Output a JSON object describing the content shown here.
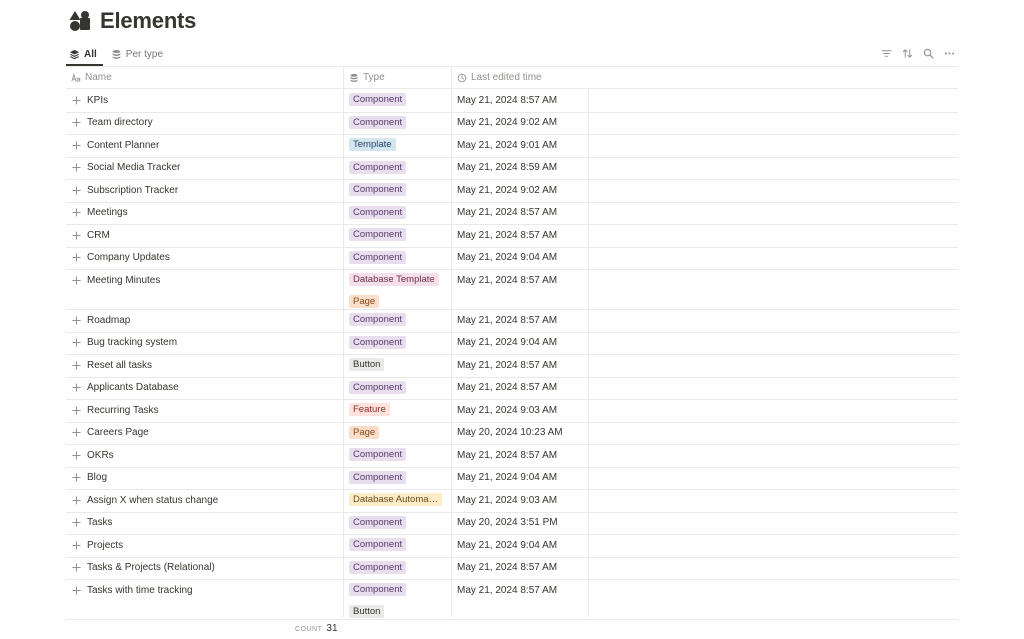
{
  "page": {
    "title": "Elements",
    "icon": "shapes-icon"
  },
  "tabs": [
    {
      "label": "All",
      "icon": "layers-icon",
      "active": true
    },
    {
      "label": "Per type",
      "icon": "database-icon",
      "active": false
    }
  ],
  "toolbar": {
    "icons": [
      "filter-icon",
      "sort-icon",
      "search-icon",
      "more-icon"
    ]
  },
  "columns": {
    "name": {
      "label": "Name",
      "icon": "text-type-icon"
    },
    "type": {
      "label": "Type",
      "icon": "database-icon"
    },
    "time": {
      "label": "Last edited time",
      "icon": "clock-icon"
    }
  },
  "tag_colors": {
    "Component": {
      "bg": "#e8deee",
      "fg": "#5a3a6e"
    },
    "Template": {
      "bg": "#d3e5ef",
      "fg": "#28456c"
    },
    "Database Template": {
      "bg": "#f5e0e9",
      "fg": "#6e2f4a"
    },
    "Page": {
      "bg": "#fadec9",
      "fg": "#854c1d"
    },
    "Button": {
      "bg": "#e9e9e7",
      "fg": "#37352f"
    },
    "Feature": {
      "bg": "#ffe2dd",
      "fg": "#8a2f23"
    },
    "Database Automa…": {
      "bg": "#fdecc8",
      "fg": "#6b4a16"
    }
  },
  "rows": [
    {
      "name": "KPIs",
      "types": [
        "Component"
      ],
      "time": "May 21, 2024 8:57 AM"
    },
    {
      "name": "Team directory",
      "types": [
        "Component"
      ],
      "time": "May 21, 2024 9:02 AM"
    },
    {
      "name": "Content Planner",
      "types": [
        "Template"
      ],
      "time": "May 21, 2024 9:01 AM"
    },
    {
      "name": "Social Media Tracker",
      "types": [
        "Component"
      ],
      "time": "May 21, 2024 8:59 AM"
    },
    {
      "name": "Subscription Tracker",
      "types": [
        "Component"
      ],
      "time": "May 21, 2024 9:02 AM"
    },
    {
      "name": "Meetings",
      "types": [
        "Component"
      ],
      "time": "May 21, 2024 8:57 AM"
    },
    {
      "name": "CRM",
      "types": [
        "Component"
      ],
      "time": "May 21, 2024 8:57 AM"
    },
    {
      "name": "Company Updates",
      "types": [
        "Component"
      ],
      "time": "May 21, 2024 9:04 AM"
    },
    {
      "name": "Meeting Minutes",
      "types": [
        "Database Template",
        "Page"
      ],
      "time": "May 21, 2024 8:57 AM"
    },
    {
      "name": "Roadmap",
      "types": [
        "Component"
      ],
      "time": "May 21, 2024 8:57 AM"
    },
    {
      "name": "Bug tracking system",
      "types": [
        "Component"
      ],
      "time": "May 21, 2024 9:04 AM"
    },
    {
      "name": "Reset all tasks",
      "types": [
        "Button"
      ],
      "time": "May 21, 2024 8:57 AM"
    },
    {
      "name": "Applicants Database",
      "types": [
        "Component"
      ],
      "time": "May 21, 2024 8:57 AM"
    },
    {
      "name": "Recurring Tasks",
      "types": [
        "Feature"
      ],
      "time": "May 21, 2024 9:03 AM"
    },
    {
      "name": "Careers Page",
      "types": [
        "Page"
      ],
      "time": "May 20, 2024 10:23 AM"
    },
    {
      "name": "OKRs",
      "types": [
        "Component"
      ],
      "time": "May 21, 2024 8:57 AM"
    },
    {
      "name": "Blog",
      "types": [
        "Component"
      ],
      "time": "May 21, 2024 9:04 AM"
    },
    {
      "name": "Assign X when status change",
      "types": [
        "Database Automa…"
      ],
      "time": "May 21, 2024 9:03 AM"
    },
    {
      "name": "Tasks",
      "types": [
        "Component"
      ],
      "time": "May 20, 2024 3:51 PM"
    },
    {
      "name": "Projects",
      "types": [
        "Component"
      ],
      "time": "May 21, 2024 9:04 AM"
    },
    {
      "name": "Tasks & Projects (Relational)",
      "types": [
        "Component"
      ],
      "time": "May 21, 2024 8:57 AM"
    },
    {
      "name": "Tasks with time tracking",
      "types": [
        "Component",
        "Button"
      ],
      "time": "May 21, 2024 8:57 AM"
    }
  ],
  "footer": {
    "count_label": "COUNT",
    "count_value": "31"
  }
}
